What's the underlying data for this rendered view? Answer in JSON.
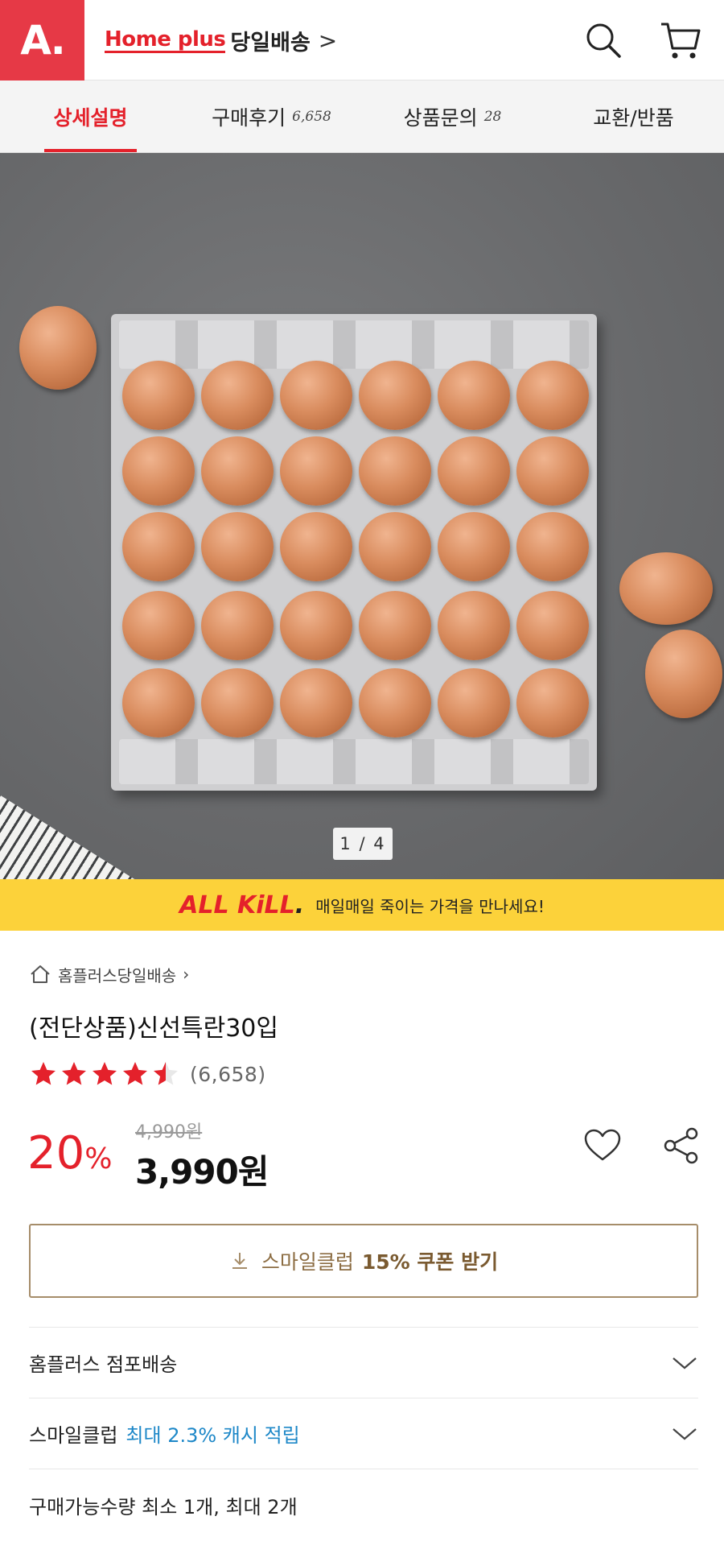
{
  "header": {
    "logo": "A.",
    "brand_name": "Home plus",
    "brand_service": "당일배송",
    "brand_chevron": ">",
    "icons": [
      "search-icon",
      "cart-icon"
    ]
  },
  "tabs": [
    {
      "label": "상세설명",
      "count": ""
    },
    {
      "label": "구매후기",
      "count": "6,658"
    },
    {
      "label": "상품문의",
      "count": "28"
    },
    {
      "label": "교환/반품",
      "count": ""
    }
  ],
  "gallery": {
    "pager": "1 / 4"
  },
  "banner": {
    "logo_red": "ALL KiLL",
    "logo_dot": ".",
    "text": "매일매일 죽이는 가격을 만나세요!"
  },
  "product": {
    "breadcrumb": "홈플러스당일배송",
    "title": "(전단상품)신선특란30입",
    "rating": 4.5,
    "review_count": "(6,658)",
    "original_price": "4,990원",
    "discount": "20",
    "discount_unit": "%",
    "price": "3,990원"
  },
  "coupon": {
    "label": "스마일클럽",
    "highlight": "15% 쿠폰 받기"
  },
  "info_rows": {
    "delivery": "홈플러스 점포배송",
    "smileclub_label": "스마일클럽",
    "smileclub_highlight": "최대 2.3% 캐시 적립",
    "purchase_limit": "구매가능수량 최소 1개, 최대 2개"
  },
  "colors": {
    "brand_red": "#e4212b",
    "banner_yellow": "#fcd23a",
    "coupon_brown": "#a68d6a",
    "link_blue": "#1e88c8"
  }
}
